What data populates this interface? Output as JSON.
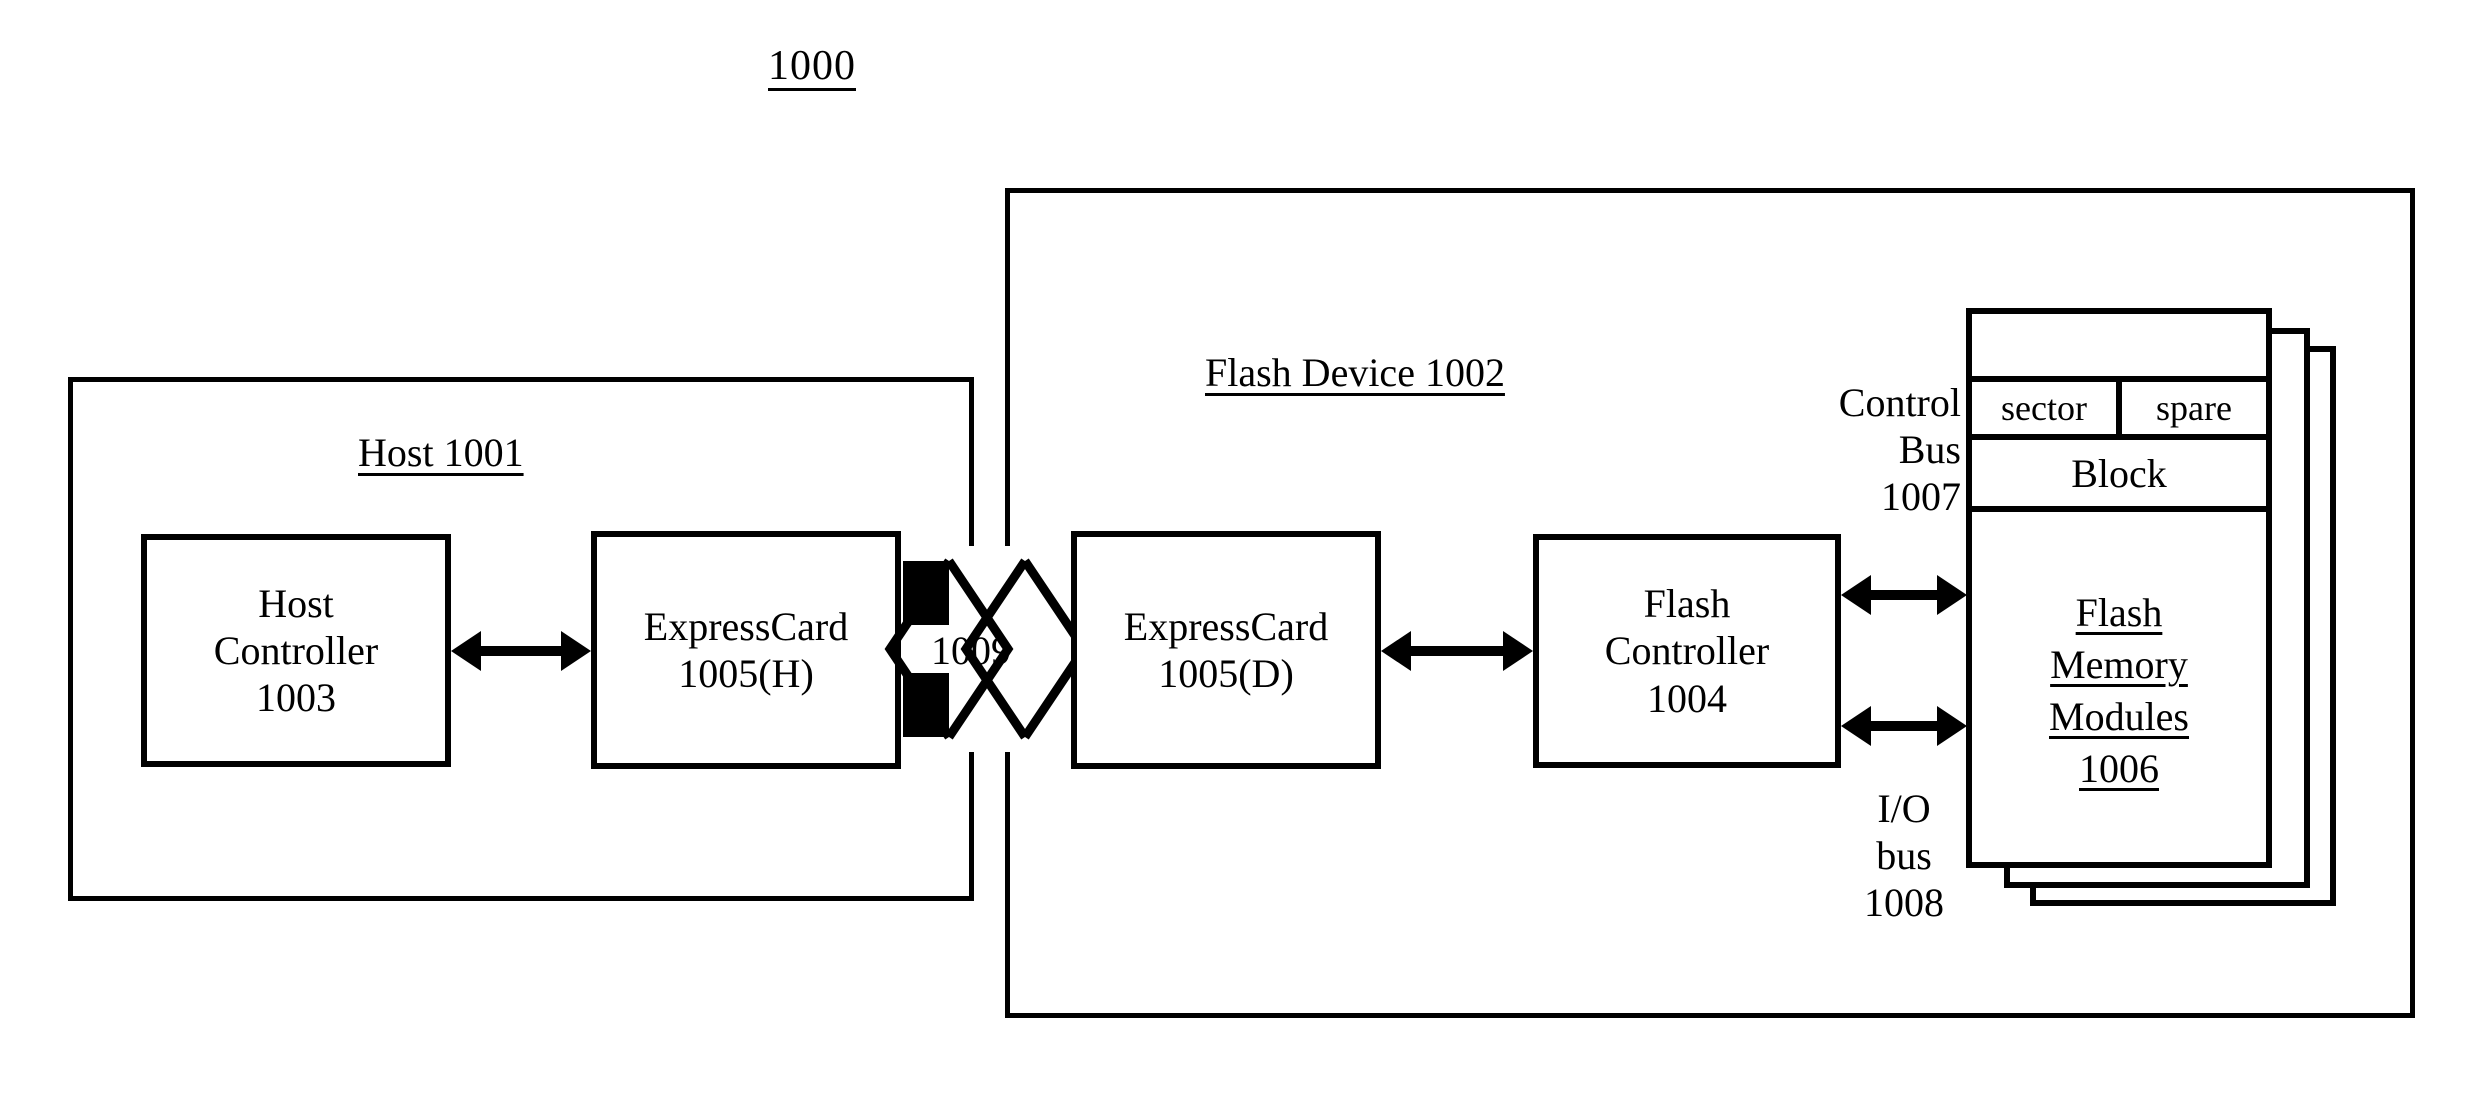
{
  "figure": {
    "number": "1000"
  },
  "host": {
    "title": "Host 1001",
    "controller": {
      "lines": [
        "Host",
        "Controller",
        "1003"
      ]
    },
    "expresscard": {
      "lines": [
        "ExpressCard",
        "1005(H)"
      ]
    }
  },
  "connector": {
    "label": "1009",
    "icon": "card-connector-icon"
  },
  "flash_device": {
    "title": "Flash Device 1002",
    "expresscard": {
      "lines": [
        "ExpressCard",
        "1005(D)"
      ]
    },
    "controller": {
      "lines": [
        "Flash",
        "Controller",
        "1004"
      ]
    },
    "control_bus": {
      "lines": [
        "Control",
        "Bus",
        "1007"
      ]
    },
    "io_bus": {
      "lines": [
        "I/O",
        "bus",
        "1008"
      ]
    },
    "memory_modules": {
      "sector_label": "sector",
      "spare_label": "spare",
      "block_label": "Block",
      "lines": [
        "Flash",
        "Memory",
        "Modules",
        "1006"
      ]
    }
  },
  "colors": {
    "stroke": "#000000",
    "background": "#ffffff"
  }
}
